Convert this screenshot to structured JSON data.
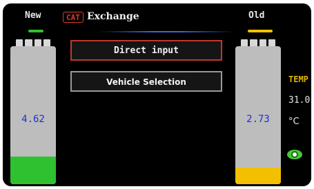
{
  "header": {
    "cat_badge": "CAT",
    "title": "Exchange",
    "new_label": "New",
    "old_label": "Old"
  },
  "batteries": {
    "new": {
      "value": "4.62",
      "level_fraction": 0.2,
      "level_color": "#2fc12f"
    },
    "old": {
      "value": "2.73",
      "level_fraction": 0.12,
      "level_color": "#f2c000"
    }
  },
  "menu": {
    "direct_input": "Direct input",
    "vehicle_selection": "Vehicle Selection"
  },
  "temperature": {
    "label": "TEMP",
    "value": "31.0",
    "unit": "°C"
  },
  "icons": {
    "view": "eye-icon"
  },
  "colors": {
    "accent_red": "#c0392b",
    "accent_yellow": "#e2b400",
    "accent_green": "#2fc12f",
    "value_blue": "#1f2fd0"
  }
}
